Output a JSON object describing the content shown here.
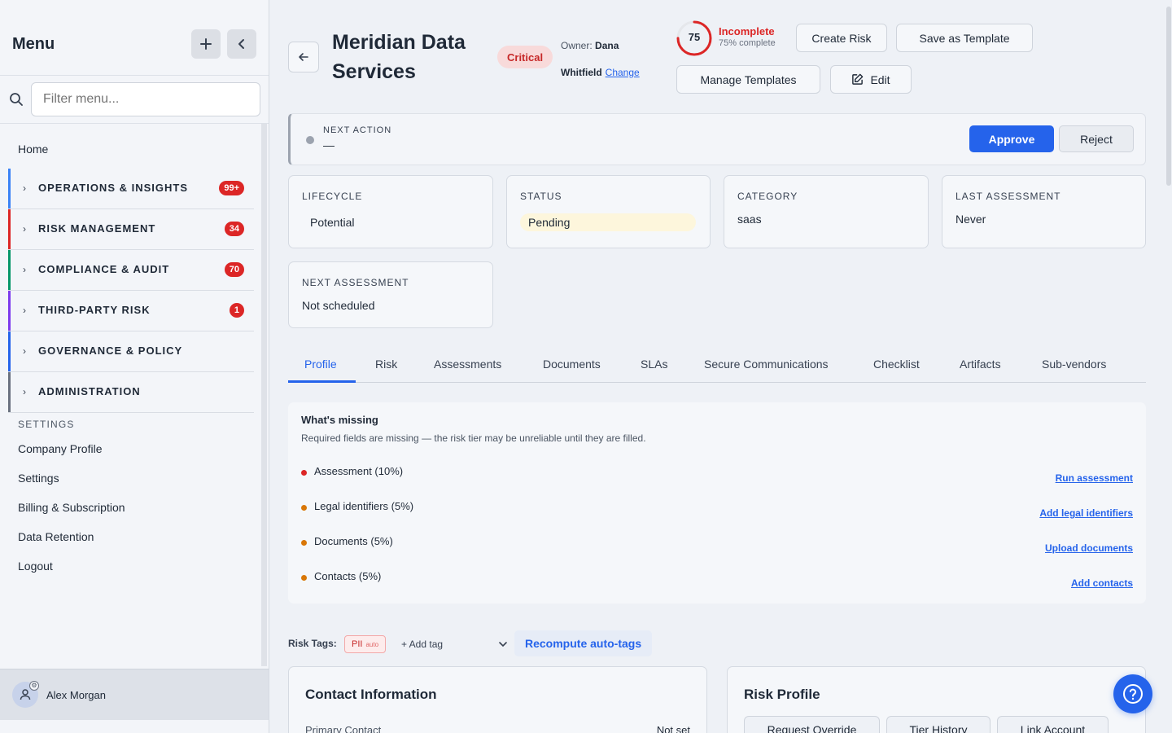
{
  "sidebar": {
    "title": "Menu",
    "search_placeholder": "Filter menu...",
    "home": "Home",
    "groups": [
      {
        "label": "OPERATIONS & INSIGHTS",
        "badge": "99+",
        "color": "#3b82f6"
      },
      {
        "label": "RISK MANAGEMENT",
        "badge": "34",
        "color": "#dc2626"
      },
      {
        "label": "COMPLIANCE & AUDIT",
        "badge": "70",
        "color": "#059669"
      },
      {
        "label": "THIRD-PARTY RISK",
        "badge": "1",
        "color": "#7c3aed"
      },
      {
        "label": "GOVERNANCE & POLICY",
        "badge": "",
        "color": "#2563eb"
      },
      {
        "label": "ADMINISTRATION",
        "badge": "",
        "color": "#6b7280"
      }
    ],
    "settings_heading": "SETTINGS",
    "settings_links": [
      "Company Profile",
      "Settings",
      "Billing & Subscription",
      "Data Retention",
      "Logout"
    ],
    "user_name": "Alex Morgan"
  },
  "header": {
    "vendor_name": "Meridian Data Services",
    "criticality": "Critical",
    "owner_label": "Owner:",
    "owner_first": "Dana",
    "owner_last": "Whitfield",
    "change_link": "Change",
    "score": "75",
    "score_status": "Incomplete",
    "score_sub": "75% complete",
    "score_fraction": 0.75,
    "buttons": {
      "create_risk": "Create Risk",
      "save_template": "Save as Template",
      "manage_templates": "Manage Templates",
      "edit": "Edit"
    }
  },
  "next_action": {
    "label": "NEXT ACTION",
    "value": "—",
    "approve": "Approve",
    "reject": "Reject"
  },
  "cards": {
    "lifecycle": {
      "label": "LIFECYCLE",
      "value": "Potential"
    },
    "status": {
      "label": "STATUS",
      "value": "Pending"
    },
    "category": {
      "label": "CATEGORY",
      "value": "saas"
    },
    "last_assessment": {
      "label": "LAST ASSESSMENT",
      "value": "Never"
    },
    "next_assessment": {
      "label": "NEXT ASSESSMENT",
      "value": "Not scheduled"
    }
  },
  "tabs": [
    "Profile",
    "Risk",
    "Assessments",
    "Documents",
    "SLAs",
    "Secure Communications",
    "Checklist",
    "Artifacts",
    "Sub-vendors"
  ],
  "active_tab": "Profile",
  "missing": {
    "title": "What's missing",
    "subtitle": "Required fields are missing — the risk tier may be unreliable until they are filled.",
    "items": [
      {
        "label": "Assessment (10%)",
        "action": "Run assessment",
        "color": "#dc2626"
      },
      {
        "label": "Legal identifiers (5%)",
        "action": "Add legal identifiers",
        "color": "#d97706"
      },
      {
        "label": "Documents (5%)",
        "action": "Upload documents",
        "color": "#d97706"
      },
      {
        "label": "Contacts (5%)",
        "action": "Add contacts",
        "color": "#d97706"
      }
    ]
  },
  "risk_tags": {
    "label": "Risk Tags:",
    "tag": "PII",
    "tag_suffix": "auto",
    "add_placeholder": "+ Add tag",
    "recompute": "Recompute auto-tags"
  },
  "contact_info": {
    "title": "Contact Information",
    "primary_label": "Primary Contact",
    "primary_value": "Not set"
  },
  "risk_profile": {
    "title": "Risk Profile",
    "buttons": [
      "Request Override",
      "Tier History",
      "Link Account"
    ]
  }
}
